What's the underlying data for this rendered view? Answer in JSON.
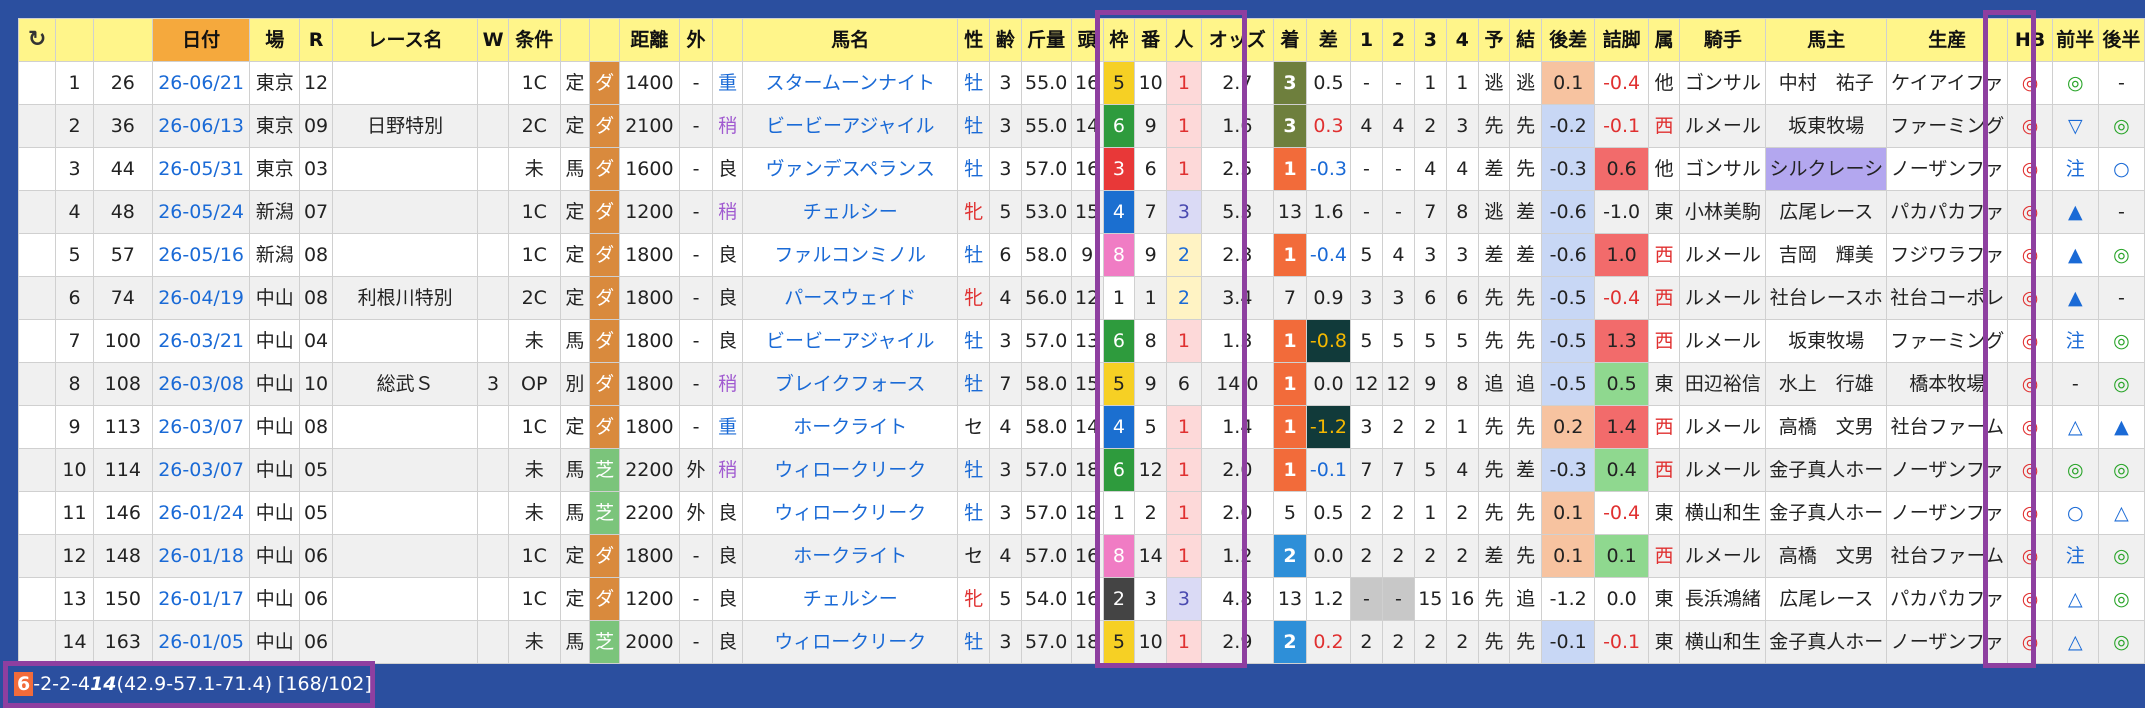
{
  "headers": {
    "refresh": "↻",
    "no": "",
    "id": "",
    "date": "日付",
    "venue": "場",
    "race_no": "R",
    "race_name": "レース名",
    "w": "W",
    "cond": "条件",
    "cond2": "",
    "surface": "",
    "distance": "距離",
    "outer": "外",
    "going": "",
    "horse": "馬名",
    "sex": "性",
    "age": "齢",
    "weight": "斤量",
    "heads": "頭",
    "waku": "枠",
    "umaban": "番",
    "popularity": "人",
    "odds": "オッズ",
    "finish": "着",
    "diff": "差",
    "c1": "1",
    "c2": "2",
    "c3": "3",
    "c4": "4",
    "yoso": "予",
    "result": "結",
    "kosa": "後差",
    "tsume": "詰脚",
    "zoku": "属",
    "jockey": "騎手",
    "owner": "馬主",
    "breeder": "生産",
    "hb": "HB",
    "zenhan": "前半",
    "kohan": "後半"
  },
  "rows": [
    {
      "no": "1",
      "id": "26",
      "date": "26-06/21",
      "venue": "東京",
      "race_no": "12",
      "race_name": "",
      "w": "",
      "cond": "1C",
      "cond2": "定",
      "surface": "ダ",
      "distance": "1400",
      "outer": "-",
      "going": "重",
      "horse": "スタームーンナイト",
      "sex": "牡",
      "age": "3",
      "weight": "55.0",
      "heads": "16",
      "waku": "5",
      "umaban": "10",
      "popularity": "1",
      "odds": "2.7",
      "finish": "3",
      "diff": "0.5",
      "c1": "-",
      "c2": "-",
      "c3": "1",
      "c4": "1",
      "yoso": "逃",
      "result": "逃",
      "kosa": "0.1",
      "tsume": "-0.4",
      "zoku": "他",
      "jockey": "ゴンサル",
      "owner": "中村　祐子",
      "breeder": "ケイアイファ",
      "hb": "◎",
      "zenhan": "◎",
      "kohan": "-"
    },
    {
      "no": "2",
      "id": "36",
      "date": "26-06/13",
      "venue": "東京",
      "race_no": "09",
      "race_name": "日野特別",
      "w": "",
      "cond": "2C",
      "cond2": "定",
      "surface": "ダ",
      "distance": "2100",
      "outer": "-",
      "going": "稍",
      "horse": "ビービーアジャイル",
      "sex": "牡",
      "age": "3",
      "weight": "55.0",
      "heads": "14",
      "waku": "6",
      "umaban": "9",
      "popularity": "1",
      "odds": "1.6",
      "finish": "3",
      "diff": "0.3",
      "c1": "4",
      "c2": "4",
      "c3": "2",
      "c4": "3",
      "yoso": "先",
      "result": "先",
      "kosa": "-0.2",
      "tsume": "-0.1",
      "zoku": "西",
      "jockey": "ルメール",
      "owner": "坂東牧場",
      "breeder": "ファーミング",
      "hb": "◎",
      "zenhan": "▽",
      "kohan": "◎"
    },
    {
      "no": "3",
      "id": "44",
      "date": "26-05/31",
      "venue": "東京",
      "race_no": "03",
      "race_name": "",
      "w": "",
      "cond": "未",
      "cond2": "馬",
      "surface": "ダ",
      "distance": "1600",
      "outer": "-",
      "going": "良",
      "horse": "ヴァンデスペランス",
      "sex": "牡",
      "age": "3",
      "weight": "57.0",
      "heads": "16",
      "waku": "3",
      "umaban": "6",
      "popularity": "1",
      "odds": "2.5",
      "finish": "1",
      "diff": "-0.3",
      "c1": "-",
      "c2": "-",
      "c3": "4",
      "c4": "4",
      "yoso": "差",
      "result": "先",
      "kosa": "-0.3",
      "tsume": "0.6",
      "zoku": "他",
      "jockey": "ゴンサル",
      "owner": "シルクレーシ",
      "breeder": "ノーザンファ",
      "hb": "◎",
      "zenhan": "注",
      "kohan": "○"
    },
    {
      "no": "4",
      "id": "48",
      "date": "26-05/24",
      "venue": "新潟",
      "race_no": "07",
      "race_name": "",
      "w": "",
      "cond": "1C",
      "cond2": "定",
      "surface": "ダ",
      "distance": "1200",
      "outer": "-",
      "going": "稍",
      "horse": "チェルシー",
      "sex": "牝",
      "age": "5",
      "weight": "53.0",
      "heads": "15",
      "waku": "4",
      "umaban": "7",
      "popularity": "3",
      "odds": "5.3",
      "finish": "13",
      "diff": "1.6",
      "c1": "-",
      "c2": "-",
      "c3": "7",
      "c4": "8",
      "yoso": "逃",
      "result": "差",
      "kosa": "-0.6",
      "tsume": "-1.0",
      "zoku": "東",
      "jockey": "小林美駒",
      "owner": "広尾レース",
      "breeder": "パカパカファ",
      "hb": "◎",
      "zenhan": "▲",
      "kohan": "-"
    },
    {
      "no": "5",
      "id": "57",
      "date": "26-05/16",
      "venue": "新潟",
      "race_no": "08",
      "race_name": "",
      "w": "",
      "cond": "1C",
      "cond2": "定",
      "surface": "ダ",
      "distance": "1800",
      "outer": "-",
      "going": "良",
      "horse": "ファルコンミノル",
      "sex": "牡",
      "age": "6",
      "weight": "58.0",
      "heads": "9",
      "waku": "8",
      "umaban": "9",
      "popularity": "2",
      "odds": "2.3",
      "finish": "1",
      "diff": "-0.4",
      "c1": "5",
      "c2": "4",
      "c3": "3",
      "c4": "3",
      "yoso": "差",
      "result": "差",
      "kosa": "-0.6",
      "tsume": "1.0",
      "zoku": "西",
      "jockey": "ルメール",
      "owner": "吉岡　輝美",
      "breeder": "フジワラファ",
      "hb": "◎",
      "zenhan": "▲",
      "kohan": "◎"
    },
    {
      "no": "6",
      "id": "74",
      "date": "26-04/19",
      "venue": "中山",
      "race_no": "08",
      "race_name": "利根川特別",
      "w": "",
      "cond": "2C",
      "cond2": "定",
      "surface": "ダ",
      "distance": "1800",
      "outer": "-",
      "going": "良",
      "horse": "パースウェイド",
      "sex": "牝",
      "age": "4",
      "weight": "56.0",
      "heads": "12",
      "waku": "1",
      "umaban": "1",
      "popularity": "2",
      "odds": "3.4",
      "finish": "7",
      "diff": "0.9",
      "c1": "3",
      "c2": "3",
      "c3": "6",
      "c4": "6",
      "yoso": "先",
      "result": "先",
      "kosa": "-0.5",
      "tsume": "-0.4",
      "zoku": "西",
      "jockey": "ルメール",
      "owner": "社台レースホ",
      "breeder": "社台コーポレ",
      "hb": "◎",
      "zenhan": "▲",
      "kohan": "-"
    },
    {
      "no": "7",
      "id": "100",
      "date": "26-03/21",
      "venue": "中山",
      "race_no": "04",
      "race_name": "",
      "w": "",
      "cond": "未",
      "cond2": "馬",
      "surface": "ダ",
      "distance": "1800",
      "outer": "-",
      "going": "良",
      "horse": "ビービーアジャイル",
      "sex": "牡",
      "age": "3",
      "weight": "57.0",
      "heads": "13",
      "waku": "6",
      "umaban": "8",
      "popularity": "1",
      "odds": "1.3",
      "finish": "1",
      "diff": "-0.8",
      "c1": "5",
      "c2": "5",
      "c3": "5",
      "c4": "5",
      "yoso": "先",
      "result": "先",
      "kosa": "-0.5",
      "tsume": "1.3",
      "zoku": "西",
      "jockey": "ルメール",
      "owner": "坂東牧場",
      "breeder": "ファーミング",
      "hb": "◎",
      "zenhan": "注",
      "kohan": "◎"
    },
    {
      "no": "8",
      "id": "108",
      "date": "26-03/08",
      "venue": "中山",
      "race_no": "10",
      "race_name": "総武Ｓ",
      "w": "3",
      "cond": "OP",
      "cond2": "別",
      "surface": "ダ",
      "distance": "1800",
      "outer": "-",
      "going": "稍",
      "horse": "ブレイクフォース",
      "sex": "牡",
      "age": "7",
      "weight": "58.0",
      "heads": "15",
      "waku": "5",
      "umaban": "9",
      "popularity": "6",
      "odds": "14.0",
      "finish": "1",
      "diff": "0.0",
      "c1": "12",
      "c2": "12",
      "c3": "9",
      "c4": "8",
      "yoso": "追",
      "result": "追",
      "kosa": "-0.5",
      "tsume": "0.5",
      "zoku": "東",
      "jockey": "田辺裕信",
      "owner": "水上　行雄",
      "breeder": "橋本牧場",
      "hb": "◎",
      "zenhan": "-",
      "kohan": "◎"
    },
    {
      "no": "9",
      "id": "113",
      "date": "26-03/07",
      "venue": "中山",
      "race_no": "08",
      "race_name": "",
      "w": "",
      "cond": "1C",
      "cond2": "定",
      "surface": "ダ",
      "distance": "1800",
      "outer": "-",
      "going": "重",
      "horse": "ホークライト",
      "sex": "セ",
      "age": "4",
      "weight": "58.0",
      "heads": "14",
      "waku": "4",
      "umaban": "5",
      "popularity": "1",
      "odds": "1.4",
      "finish": "1",
      "diff": "-1.2",
      "c1": "3",
      "c2": "2",
      "c3": "2",
      "c4": "1",
      "yoso": "先",
      "result": "先",
      "kosa": "0.2",
      "tsume": "1.4",
      "zoku": "西",
      "jockey": "ルメール",
      "owner": "高橋　文男",
      "breeder": "社台ファーム",
      "hb": "◎",
      "zenhan": "△",
      "kohan": "▲"
    },
    {
      "no": "10",
      "id": "114",
      "date": "26-03/07",
      "venue": "中山",
      "race_no": "05",
      "race_name": "",
      "w": "",
      "cond": "未",
      "cond2": "馬",
      "surface": "芝",
      "distance": "2200",
      "outer": "外",
      "going": "稍",
      "horse": "ウィロークリーク",
      "sex": "牡",
      "age": "3",
      "weight": "57.0",
      "heads": "18",
      "waku": "6",
      "umaban": "12",
      "popularity": "1",
      "odds": "2.0",
      "finish": "1",
      "diff": "-0.1",
      "c1": "7",
      "c2": "7",
      "c3": "5",
      "c4": "4",
      "yoso": "先",
      "result": "差",
      "kosa": "-0.3",
      "tsume": "0.4",
      "zoku": "西",
      "jockey": "ルメール",
      "owner": "金子真人ホー",
      "breeder": "ノーザンファ",
      "hb": "◎",
      "zenhan": "◎",
      "kohan": "◎"
    },
    {
      "no": "11",
      "id": "146",
      "date": "26-01/24",
      "venue": "中山",
      "race_no": "05",
      "race_name": "",
      "w": "",
      "cond": "未",
      "cond2": "馬",
      "surface": "芝",
      "distance": "2200",
      "outer": "外",
      "going": "良",
      "horse": "ウィロークリーク",
      "sex": "牡",
      "age": "3",
      "weight": "57.0",
      "heads": "18",
      "waku": "1",
      "umaban": "2",
      "popularity": "1",
      "odds": "2.0",
      "finish": "5",
      "diff": "0.5",
      "c1": "2",
      "c2": "2",
      "c3": "1",
      "c4": "2",
      "yoso": "先",
      "result": "先",
      "kosa": "0.1",
      "tsume": "-0.4",
      "zoku": "東",
      "jockey": "横山和生",
      "owner": "金子真人ホー",
      "breeder": "ノーザンファ",
      "hb": "◎",
      "zenhan": "○",
      "kohan": "△"
    },
    {
      "no": "12",
      "id": "148",
      "date": "26-01/18",
      "venue": "中山",
      "race_no": "06",
      "race_name": "",
      "w": "",
      "cond": "1C",
      "cond2": "定",
      "surface": "ダ",
      "distance": "1800",
      "outer": "-",
      "going": "良",
      "horse": "ホークライト",
      "sex": "セ",
      "age": "4",
      "weight": "57.0",
      "heads": "16",
      "waku": "8",
      "umaban": "14",
      "popularity": "1",
      "odds": "1.2",
      "finish": "2",
      "diff": "0.0",
      "c1": "2",
      "c2": "2",
      "c3": "2",
      "c4": "2",
      "yoso": "差",
      "result": "先",
      "kosa": "0.1",
      "tsume": "0.1",
      "zoku": "西",
      "jockey": "ルメール",
      "owner": "高橋　文男",
      "breeder": "社台ファーム",
      "hb": "◎",
      "zenhan": "注",
      "kohan": "◎"
    },
    {
      "no": "13",
      "id": "150",
      "date": "26-01/17",
      "venue": "中山",
      "race_no": "06",
      "race_name": "",
      "w": "",
      "cond": "1C",
      "cond2": "定",
      "surface": "ダ",
      "distance": "1200",
      "outer": "-",
      "going": "良",
      "horse": "チェルシー",
      "sex": "牝",
      "age": "5",
      "weight": "54.0",
      "heads": "16",
      "waku": "2",
      "umaban": "3",
      "popularity": "3",
      "odds": "4.8",
      "finish": "13",
      "diff": "1.2",
      "c1": "-",
      "c2": "-",
      "c3": "15",
      "c4": "16",
      "yoso": "先",
      "result": "追",
      "kosa": "-1.2",
      "tsume": "0.0",
      "zoku": "東",
      "jockey": "長浜鴻緒",
      "owner": "広尾レース",
      "breeder": "パカパカファ",
      "hb": "◎",
      "zenhan": "△",
      "kohan": "◎"
    },
    {
      "no": "14",
      "id": "163",
      "date": "26-01/05",
      "venue": "中山",
      "race_no": "06",
      "race_name": "",
      "w": "",
      "cond": "未",
      "cond2": "馬",
      "surface": "芝",
      "distance": "2000",
      "outer": "-",
      "going": "良",
      "horse": "ウィロークリーク",
      "sex": "牡",
      "age": "3",
      "weight": "57.0",
      "heads": "18",
      "waku": "5",
      "umaban": "10",
      "popularity": "1",
      "odds": "2.9",
      "finish": "2",
      "diff": "0.2",
      "c1": "2",
      "c2": "2",
      "c3": "2",
      "c4": "2",
      "yoso": "先",
      "result": "先",
      "kosa": "-0.1",
      "tsume": "-0.1",
      "zoku": "東",
      "jockey": "横山和生",
      "owner": "金子真人ホー",
      "breeder": "ノーザンファ",
      "hb": "◎",
      "zenhan": "△",
      "kohan": "◎"
    }
  ],
  "status": {
    "first": "6",
    "rest": "-2-2-4 ",
    "total": "14",
    "rates": " (42.9-57.1-71.4) [168/102]"
  },
  "colors": {
    "background": "#2b4f9f",
    "header": "#fff58a",
    "date_header": "#f5a93d",
    "highlight_border": "#8e3fa0",
    "link": "#1a6ad6"
  }
}
